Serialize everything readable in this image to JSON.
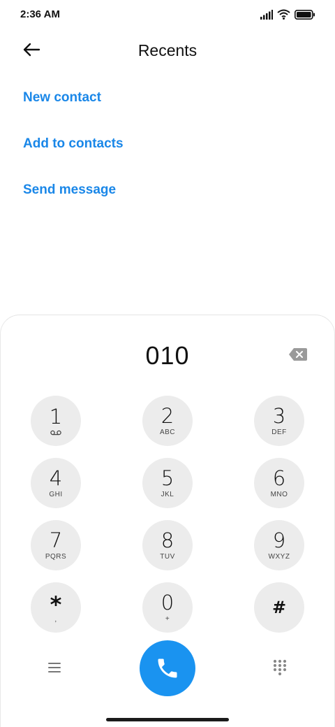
{
  "status_bar": {
    "time": "2:36 AM",
    "icons": [
      "signal-icon",
      "wifi-icon",
      "battery-icon"
    ]
  },
  "header": {
    "title": "Recents",
    "back_icon": "back-arrow-icon"
  },
  "actions": [
    {
      "label": "New contact"
    },
    {
      "label": "Add to contacts"
    },
    {
      "label": "Send message"
    }
  ],
  "dialer": {
    "number": "010",
    "backspace_icon": "backspace-icon",
    "keys": [
      {
        "digit": "1",
        "letters": "",
        "sub_icon": "voicemail-icon"
      },
      {
        "digit": "2",
        "letters": "ABC"
      },
      {
        "digit": "3",
        "letters": "DEF"
      },
      {
        "digit": "4",
        "letters": "GHI"
      },
      {
        "digit": "5",
        "letters": "JKL"
      },
      {
        "digit": "6",
        "letters": "MNO"
      },
      {
        "digit": "7",
        "letters": "PQRS"
      },
      {
        "digit": "8",
        "letters": "TUV"
      },
      {
        "digit": "9",
        "letters": "WXYZ"
      },
      {
        "digit": "*",
        "letters": ","
      },
      {
        "digit": "0",
        "letters": "+"
      },
      {
        "digit": "#",
        "letters": ""
      }
    ]
  },
  "bottom_bar": {
    "menu_icon": "menu-icon",
    "call_icon": "phone-icon",
    "keypad_icon": "keypad-icon"
  },
  "colors": {
    "accent": "#1a87e8",
    "call_button": "#1a93f0",
    "key_background": "#ececec"
  }
}
